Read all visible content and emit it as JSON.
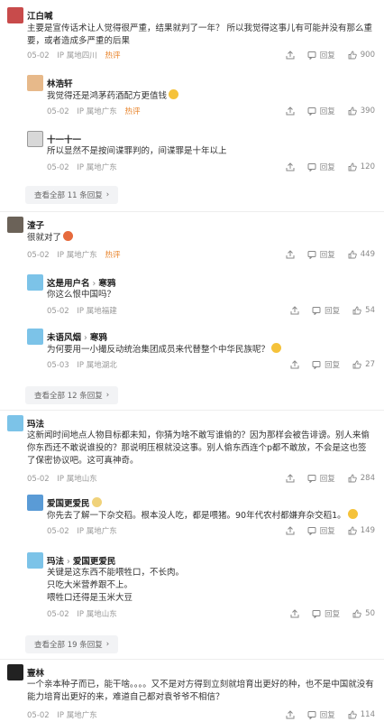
{
  "threads": [
    {
      "name": "江白喊",
      "text": "主要是宣传话术让人觉得很严重，结果就判了一年？ 所以我觉得这事儿有可能并没有那么重要，或者造成多严重的后果",
      "date": "05-02",
      "ip": "IP 属地四川",
      "hot": "热评",
      "reply_label": "回复",
      "likes": "900",
      "replies": [
        {
          "name": "林浩轩",
          "text": "我觉得还是鸿茅药酒配方更值钱",
          "date": "05-02",
          "ip": "IP 属地广东",
          "hot": "热评",
          "reply_label": "回复",
          "likes": "390"
        },
        {
          "name": "十一十一",
          "text": "所以显然不是按间谍罪判的，间谍罪是十年以上",
          "date": "05-02",
          "ip": "IP 属地广东",
          "hot": "",
          "reply_label": "回复",
          "likes": "120"
        }
      ],
      "view_all": "查看全部 11 条回复"
    },
    {
      "name": "渣子",
      "text": "很就对了",
      "date": "05-02",
      "ip": "IP 属地广东",
      "hot": "热评",
      "reply_label": "回复",
      "likes": "449",
      "replies": [
        {
          "name": "这是用户名",
          "reply_to": "寒鸦",
          "text": "你这么恨中国吗？",
          "date": "05-02",
          "ip": "IP 属地福建",
          "hot": "",
          "reply_label": "回复",
          "likes": "54"
        },
        {
          "name": "未语风烟",
          "reply_to": "寒鸦",
          "text": "为何要用一小撮反动统治集团成员来代替整个中华民族呢？",
          "date": "05-03",
          "ip": "IP 属地湖北",
          "hot": "",
          "reply_label": "回复",
          "likes": "27"
        }
      ],
      "view_all": "查看全部 12 条回复"
    },
    {
      "name": "玛法",
      "text": "这新闻时间地点人物目标都未知，你猜为啥不敢写谁偷的？因为那样会被告诽谤。别人来偷你东西还不敢说谁投的？那说明压根就没这事。别人偷东西连个p都不敢放，不会是这也签了保密协议吧。这可真神奇。",
      "date": "05-02",
      "ip": "IP 属地山东",
      "hot": "",
      "reply_label": "回复",
      "likes": "284",
      "replies": [
        {
          "name": "爱国更爱民",
          "text": "你先去了解一下杂交稻。根本没人吃，都是喂猪。90年代农村都嫌弃杂交稻1。",
          "date": "05-02",
          "ip": "IP 属地广东",
          "hot": "",
          "reply_label": "回复",
          "likes": "149"
        },
        {
          "name": "玛法",
          "reply_to": "爱国更爱民",
          "text": "关键是这东西不能喂牲口，不长肉。\n只吃大米营养跟不上。\n喂牲口还得是玉米大豆",
          "date": "05-02",
          "ip": "IP 属地山东",
          "hot": "",
          "reply_label": "回复",
          "likes": "50"
        }
      ],
      "view_all": "查看全部 19 条回复"
    },
    {
      "name": "壹林",
      "text": "一个亲本种子而已，能干啥。。。。又不是对方得到立刻就培育出更好的种，也不是中国就没有能力培育出更好的来，难道自己都对袁爷爷不相信？",
      "date": "05-02",
      "ip": "IP 属地广东",
      "hot": "",
      "reply_label": "回复",
      "likes": "114",
      "replies": [],
      "view_all": ""
    }
  ],
  "colors": {
    "hot": "#e8832a",
    "muted": "#999999",
    "accent": "#3e7de0"
  },
  "icons": [
    "share-icon",
    "comment-icon",
    "like-icon",
    "chevron-right-icon"
  ]
}
